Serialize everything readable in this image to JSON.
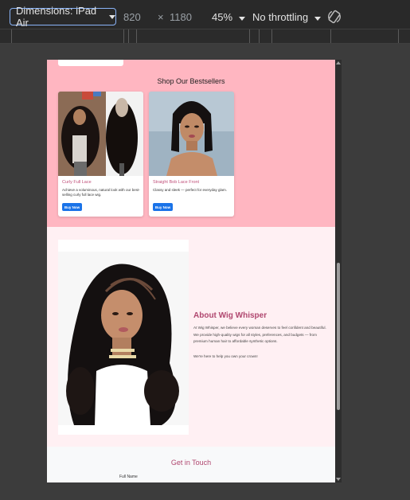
{
  "toolbar": {
    "dimensions_label": "Dimensions: iPad Air",
    "width": "820",
    "times": "×",
    "height": "1180",
    "zoom": "45%",
    "throttling": "No throttling"
  },
  "colors": {
    "hero_bg": "#ffb6c1",
    "about_bg": "#fff0f3",
    "accent": "#b0476f",
    "button": "#1a73e8"
  },
  "bestsellers": {
    "title": "Shop Our Bestsellers",
    "products": [
      {
        "name": "Curly Full Lace",
        "description": "Achieve a voluminous, natural look with our best-selling curly full lace wig.",
        "button": "Buy Now"
      },
      {
        "name": "Straight Bob Lace Front",
        "description": "Classy and sleek — perfect for everyday glam.",
        "button": "Buy Now"
      }
    ]
  },
  "about": {
    "title": "About Wig Whisper",
    "paragraph1": "At Wig Whisper, we believe every woman deserves to feel confident and beautiful. We provide high-quality wigs for all styles, preferences, and budgets — from premium human hair to affordable synthetic options.",
    "paragraph2": "We're here to help you own your crown!"
  },
  "contact": {
    "title": "Get in Touch",
    "full_name_label": "Full Name"
  }
}
